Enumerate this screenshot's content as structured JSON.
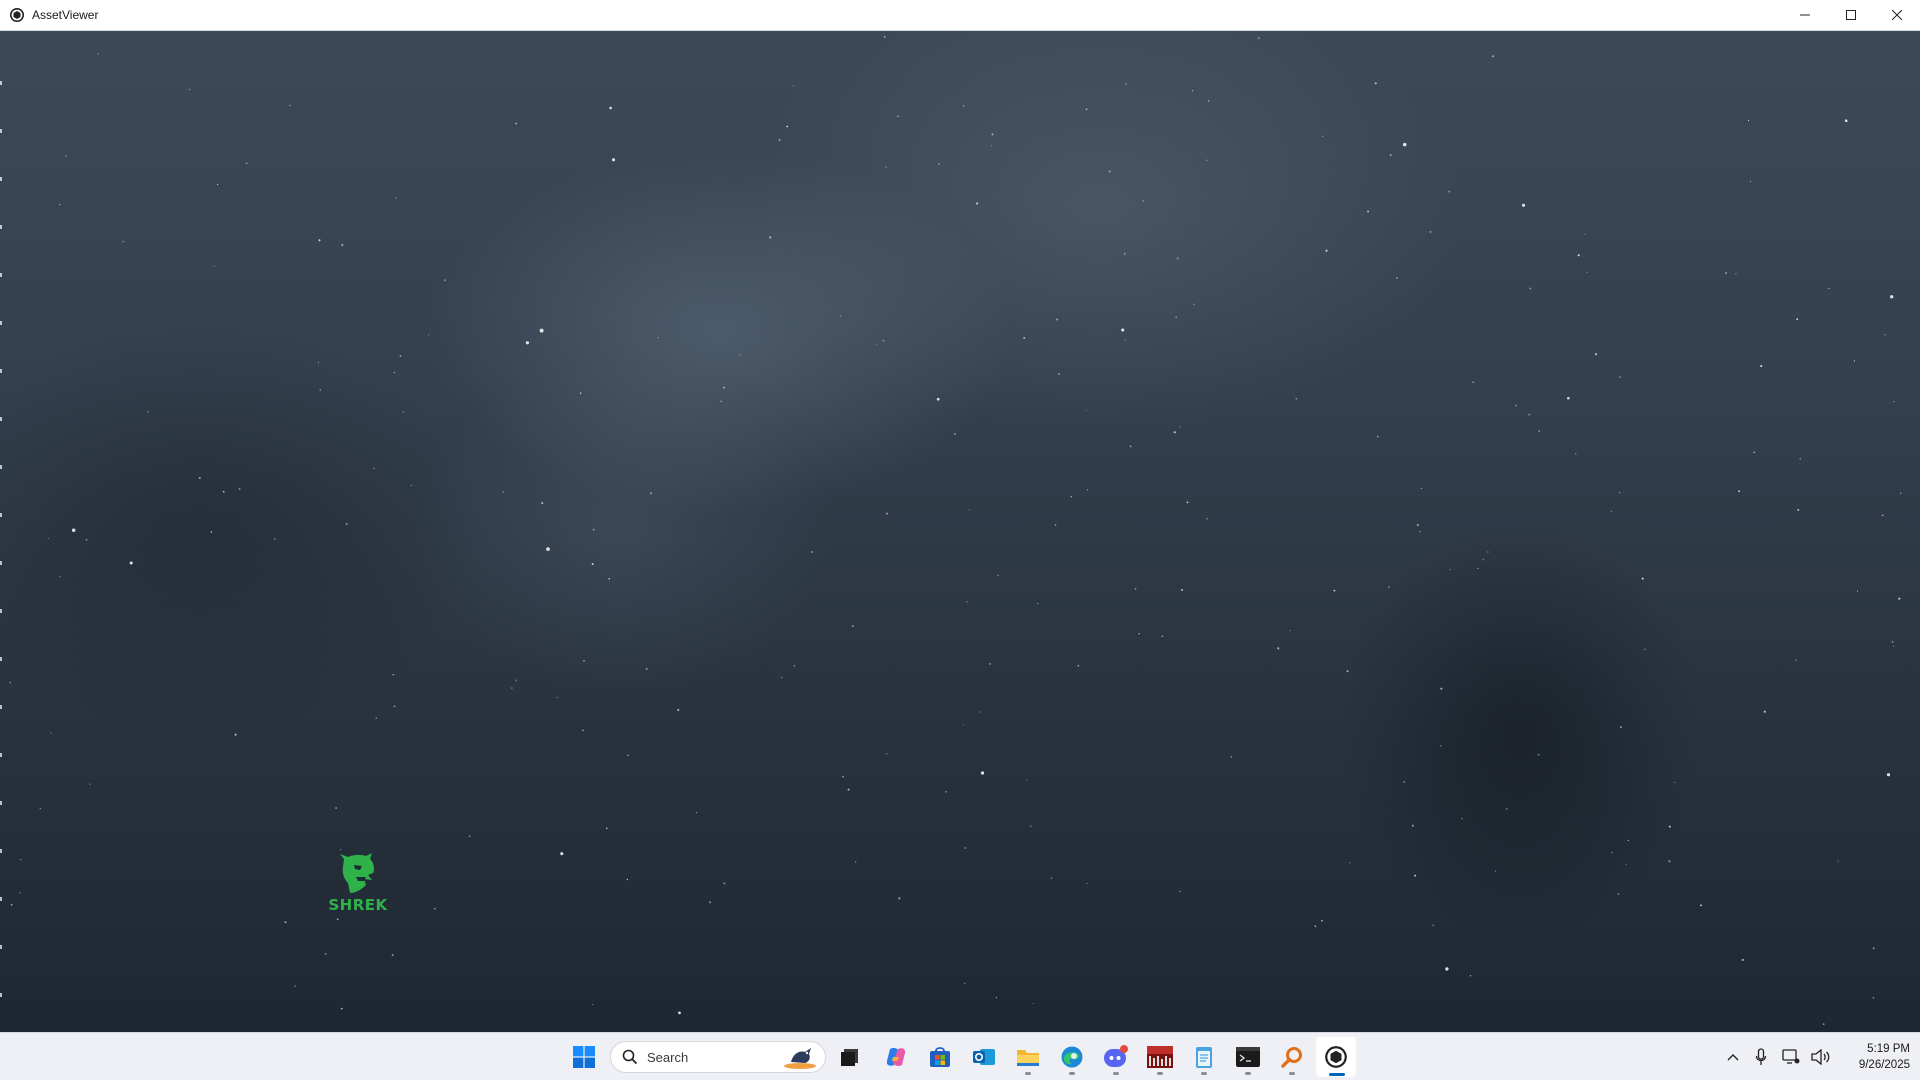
{
  "window": {
    "title": "AssetViewer",
    "icon": "assetviewer-icon",
    "controls": [
      "minimize-icon",
      "maximize-icon",
      "close-icon"
    ]
  },
  "viewport": {
    "background": "night-sky-nebula",
    "logo_text": "SHREK",
    "logo_color": "#2fb24a"
  },
  "taskbar": {
    "search_placeholder": "Search",
    "apps": [
      {
        "name": "start",
        "icon": "windows-start-icon"
      },
      {
        "name": "task-view",
        "icon": "task-view-icon"
      },
      {
        "name": "copilot",
        "icon": "copilot-icon"
      },
      {
        "name": "microsoft-store",
        "icon": "store-icon"
      },
      {
        "name": "outlook",
        "icon": "outlook-icon"
      },
      {
        "name": "file-explorer",
        "icon": "folder-icon"
      },
      {
        "name": "edge",
        "icon": "edge-icon"
      },
      {
        "name": "discord",
        "icon": "discord-icon",
        "badge": "9+"
      },
      {
        "name": "voicemeeter",
        "icon": "voicemeeter-icon",
        "icon_text": "VOICE METER"
      },
      {
        "name": "notepad",
        "icon": "notepad-icon"
      },
      {
        "name": "terminal",
        "icon": "terminal-icon"
      },
      {
        "name": "search-tool",
        "icon": "magnifier-icon"
      },
      {
        "name": "assetviewer",
        "icon": "assetviewer-icon"
      }
    ],
    "tray_icons": [
      "chevron-up-icon",
      "microphone-icon",
      "network-icon",
      "speaker-icon"
    ],
    "time": "5:19 PM",
    "date": "9/26/2025"
  }
}
